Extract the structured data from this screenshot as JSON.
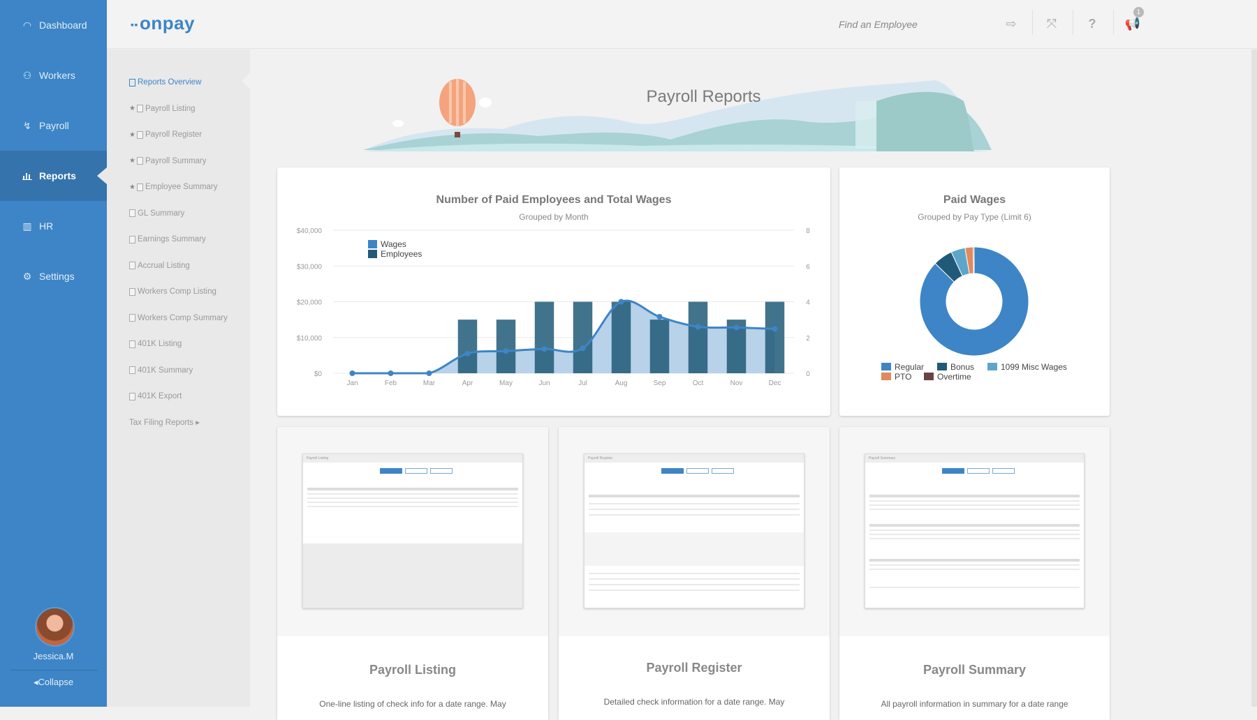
{
  "sidebar": {
    "items": [
      {
        "label": "Dashboard",
        "icon": "gauge-icon",
        "glyph": "◠"
      },
      {
        "label": "Workers",
        "icon": "users-icon",
        "glyph": "👥"
      },
      {
        "label": "Payroll",
        "icon": "payroll-hand-icon",
        "glyph": "✋"
      },
      {
        "label": "Reports",
        "icon": "bar-chart-icon",
        "glyph": "▂▄▆",
        "active": true
      },
      {
        "label": "HR",
        "icon": "books-icon",
        "glyph": "▥"
      },
      {
        "label": "Settings",
        "icon": "gear-icon",
        "glyph": "⚙"
      }
    ],
    "user_name": "Jessica.M",
    "collapse_label": "Collapse"
  },
  "header": {
    "logo": "onpay",
    "search_placeholder": "Find an Employee",
    "icons": [
      "logout-icon",
      "fullscreen-icon",
      "help-icon",
      "announcements-icon"
    ],
    "notification_count": "1"
  },
  "subnav": {
    "items": [
      {
        "label": "Reports Overview",
        "starred": false,
        "active": true
      },
      {
        "label": "Payroll Listing",
        "starred": true
      },
      {
        "label": "Payroll Register",
        "starred": true
      },
      {
        "label": "Payroll Summary",
        "starred": true
      },
      {
        "label": "Employee Summary",
        "starred": true
      },
      {
        "label": "GL Summary",
        "starred": false
      },
      {
        "label": "Earnings Summary",
        "starred": false
      },
      {
        "label": "Accrual Listing",
        "starred": false
      },
      {
        "label": "Workers Comp Listing",
        "starred": false
      },
      {
        "label": "Workers Comp Summary",
        "starred": false
      },
      {
        "label": "401K Listing",
        "starred": false
      },
      {
        "label": "401K Summary",
        "starred": false
      },
      {
        "label": "401K Export",
        "starred": false
      }
    ],
    "tax_filing_label": "Tax Filing Reports ▸"
  },
  "main": {
    "page_title": "Payroll Reports",
    "report_cards": [
      {
        "title": "Payroll Listing",
        "description": "One-line listing of check info for a date range. May",
        "thumb_title": "Payroll Listing"
      },
      {
        "title": "Payroll Register",
        "description": "Detailed check information for a date range. May",
        "thumb_title": "Payroll Register"
      },
      {
        "title": "Payroll Summary",
        "description": "All payroll information in summary for a date range",
        "thumb_title": "Payroll Summary"
      }
    ]
  },
  "colors": {
    "brand": "#3d85c6",
    "wages_line": "#3d85c6",
    "wages_area": "#b3d0e8",
    "employees_bar": "#215a78"
  },
  "chart_data": [
    {
      "type": "bar",
      "title": "Number of Paid Employees and Total Wages",
      "subtitle": "Grouped by Month",
      "categories": [
        "Jan",
        "Feb",
        "Mar",
        "Apr",
        "May",
        "Jun",
        "Jul",
        "Aug",
        "Sep",
        "Oct",
        "Nov",
        "Dec"
      ],
      "series": [
        {
          "name": "Wages",
          "kind": "area-line",
          "axis": "left",
          "color": "#3d85c6",
          "values": [
            0,
            0,
            0,
            5500,
            6200,
            6800,
            7000,
            20000,
            15800,
            13000,
            12800,
            12400
          ]
        },
        {
          "name": "Employees",
          "kind": "bar",
          "axis": "right",
          "color": "#215a78",
          "values": [
            0,
            0,
            0,
            3,
            3,
            4,
            4,
            4,
            3,
            4,
            3,
            4
          ]
        }
      ],
      "y_left": {
        "ticks": [
          "$0",
          "$10,000",
          "$20,000",
          "$30,000",
          "$40,000"
        ],
        "range": [
          0,
          40000
        ]
      },
      "y_right": {
        "ticks": [
          "0",
          "2",
          "4",
          "6",
          "8"
        ],
        "range": [
          0,
          8
        ]
      },
      "legend": {
        "position": "top-left",
        "entries": [
          "Wages",
          "Employees"
        ]
      },
      "grid": true
    },
    {
      "type": "pie",
      "variant": "donut",
      "title": "Paid Wages",
      "subtitle": "Grouped by Pay Type (Limit 6)",
      "slices": [
        {
          "label": "Regular",
          "value": 87.3,
          "color": "#3d85c6"
        },
        {
          "label": "Bonus",
          "value": 5.8,
          "color": "#215a78"
        },
        {
          "label": "1099 Misc Wages",
          "value": 4.2,
          "color": "#5ea6c9"
        },
        {
          "label": "PTO",
          "value": 2.4,
          "color": "#e08a5e"
        },
        {
          "label": "Overtime",
          "value": 0.3,
          "color": "#6b4444"
        }
      ],
      "legend": {
        "position": "bottom"
      }
    }
  ]
}
